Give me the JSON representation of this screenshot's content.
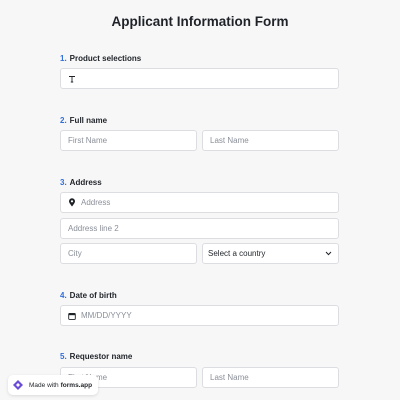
{
  "form": {
    "title": "Applicant Information Form",
    "questions": [
      {
        "num": "1.",
        "label": "Product selections"
      },
      {
        "num": "2.",
        "label": "Full name"
      },
      {
        "num": "3.",
        "label": "Address"
      },
      {
        "num": "4.",
        "label": "Date of birth"
      },
      {
        "num": "5.",
        "label": "Requestor name"
      }
    ],
    "full_name": {
      "first_placeholder": "First Name",
      "last_placeholder": "Last Name"
    },
    "address": {
      "line1_placeholder": "Address",
      "line2_placeholder": "Address line 2",
      "city_placeholder": "City",
      "country_selected": "Select a country"
    },
    "dob": {
      "placeholder": "MM/DD/YYYY"
    },
    "requestor": {
      "first_placeholder": "First Name",
      "last_placeholder": "Last Name"
    }
  },
  "badge": {
    "prefix": "Made with",
    "brand": "forms.app"
  },
  "icons": {
    "text_field": "text-format-icon",
    "address": "location-pin-icon",
    "date": "calendar-icon",
    "select": "chevron-down-icon",
    "brand": "forms-app-logo-icon"
  },
  "colors": {
    "accent": "#2f6fd8",
    "brand": "#6b4cd6"
  }
}
